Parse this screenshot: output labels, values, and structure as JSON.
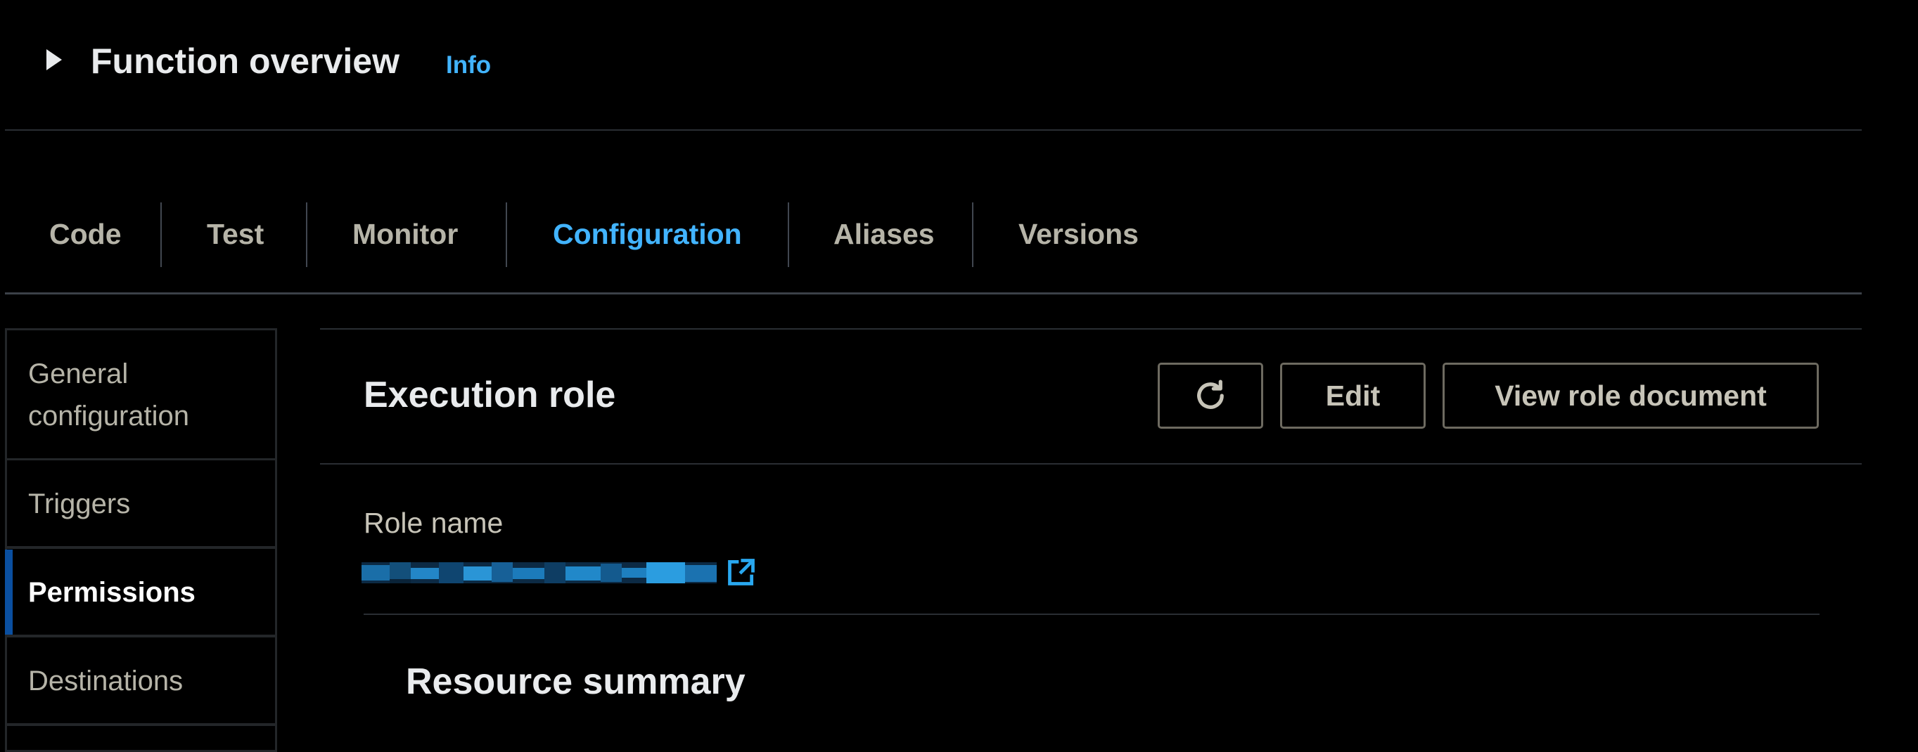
{
  "header": {
    "title": "Function overview",
    "info": "Info"
  },
  "tabs": [
    {
      "label": "Code"
    },
    {
      "label": "Test"
    },
    {
      "label": "Monitor"
    },
    {
      "label": "Configuration",
      "active": true
    },
    {
      "label": "Aliases"
    },
    {
      "label": "Versions"
    }
  ],
  "sidebar": {
    "items": [
      {
        "label_line1": "General",
        "label_line2": "configuration"
      },
      {
        "label": "Triggers"
      },
      {
        "label": "Permissions",
        "active": true
      },
      {
        "label": "Destinations"
      }
    ]
  },
  "execution_role": {
    "title": "Execution role",
    "refresh_icon": "refresh-icon",
    "edit_label": "Edit",
    "view_label": "View role document",
    "role_name_label": "Role name",
    "external_link_icon": "external-link-icon"
  },
  "resource_summary": {
    "title": "Resource summary"
  },
  "colors": {
    "background": "#000000",
    "accent": "#42b4ff",
    "active_indicator": "#0a4fa0",
    "text": "#e9ebed"
  }
}
